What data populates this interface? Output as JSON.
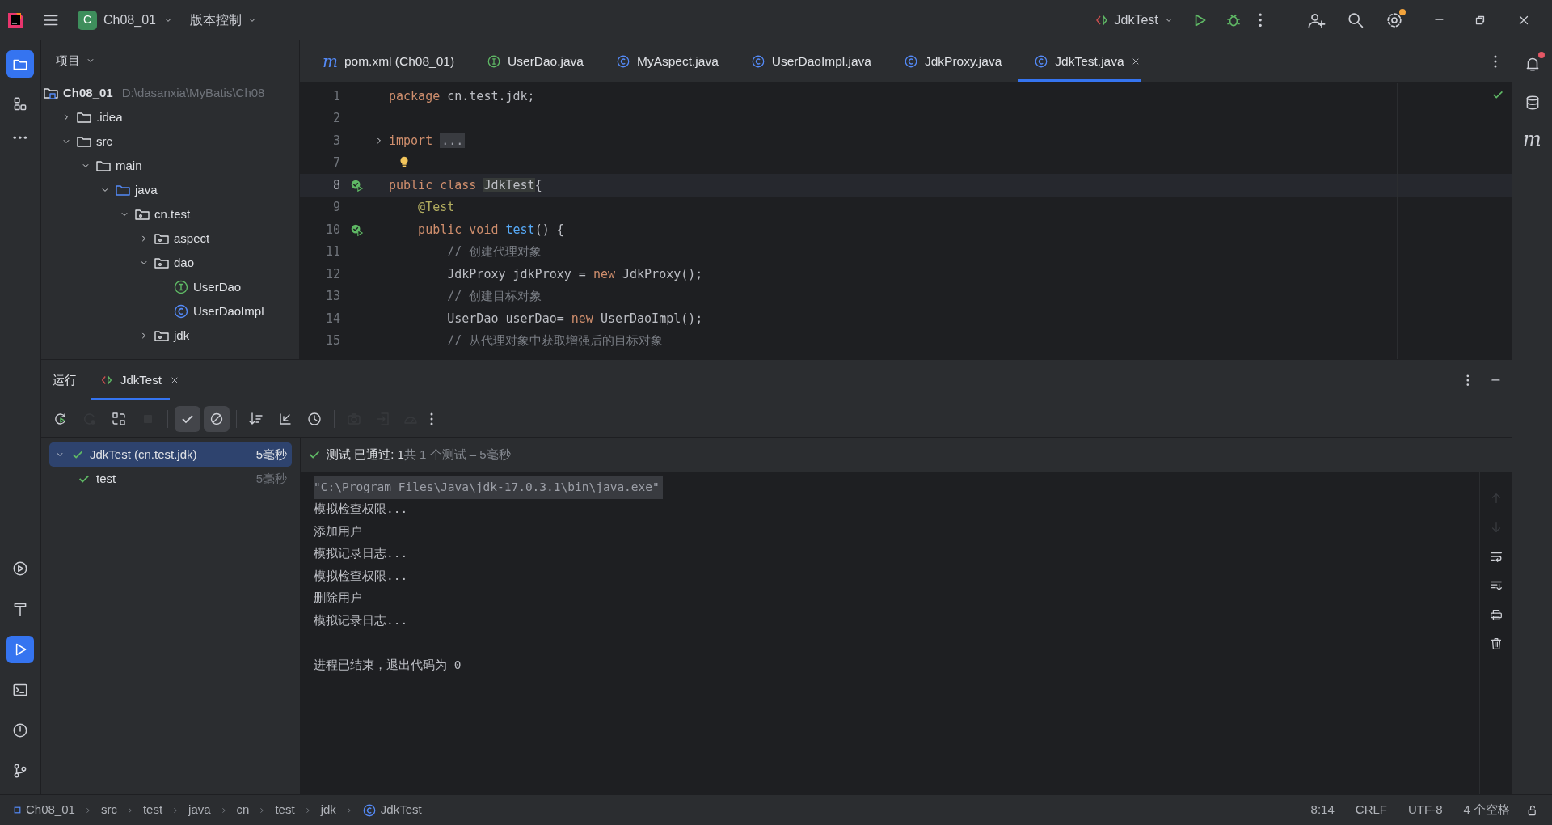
{
  "title_bar": {
    "project_letter": "C",
    "project": "Ch08_01",
    "vcs": "版本控制",
    "run_config": "JdkTest",
    "updates_available": true
  },
  "left_toolbar": {
    "top": [
      {
        "selected": true
      },
      {
        "selected": false
      },
      {
        "selected": false
      }
    ],
    "bottom": [
      {
        "selected": false
      },
      {
        "selected": false
      },
      {
        "selected": true
      },
      {
        "selected": false
      },
      {
        "selected": false
      },
      {
        "selected": false
      }
    ]
  },
  "right_toolbar": {
    "notifications_unread": true,
    "maven_label": "m"
  },
  "project_panel": {
    "title": "项目",
    "tree": [
      {
        "name": "Ch08_01",
        "path": "D:\\dasanxia\\MyBatis\\Ch08_",
        "kind": "module",
        "children": [
          {
            "name": ".idea",
            "kind": "folder",
            "expanded": false
          },
          {
            "name": "src",
            "kind": "folder",
            "expanded": true,
            "children": [
              {
                "name": "main",
                "kind": "folder",
                "expanded": true,
                "children": [
                  {
                    "name": "java",
                    "kind": "source",
                    "expanded": true,
                    "children": [
                      {
                        "name": "cn.test",
                        "kind": "package",
                        "expanded": true,
                        "children": [
                          {
                            "name": "aspect",
                            "kind": "package",
                            "expanded": false
                          },
                          {
                            "name": "dao",
                            "kind": "package",
                            "expanded": true,
                            "children": [
                              {
                                "name": "UserDao",
                                "kind": "interface"
                              },
                              {
                                "name": "UserDaoImpl",
                                "kind": "class"
                              }
                            ]
                          },
                          {
                            "name": "jdk",
                            "kind": "package",
                            "expanded": false
                          }
                        ]
                      }
                    ]
                  }
                ]
              }
            ]
          }
        ]
      }
    ]
  },
  "editor_tabs": [
    {
      "label": "pom.xml (Ch08_01)",
      "kind": "maven",
      "icon_text": "m",
      "selected": false
    },
    {
      "label": "UserDao.java",
      "kind": "interface",
      "selected": false
    },
    {
      "label": "MyAspect.java",
      "kind": "class",
      "selected": false
    },
    {
      "label": "UserDaoImpl.java",
      "kind": "class",
      "selected": false
    },
    {
      "label": "JdkProxy.java",
      "kind": "class",
      "selected": false
    },
    {
      "label": "JdkTest.java",
      "kind": "class",
      "selected": true
    }
  ],
  "code": [
    {
      "number": "1",
      "kind": "plain",
      "current": false,
      "tokens": [
        {
          "text": "package",
          "kind": "kw"
        },
        {
          "text": " cn.test.jdk;",
          "kind": "plain"
        }
      ]
    },
    {
      "number": "2",
      "kind": "plain",
      "current": false
    },
    {
      "number": "3",
      "kind": "fold",
      "current": false,
      "tokens": [
        {
          "text": "import",
          "kind": "kw"
        },
        {
          "text": "...",
          "kind": "folded"
        }
      ]
    },
    {
      "number": "7",
      "kind": "bulb",
      "current": false
    },
    {
      "number": "8",
      "kind": "run",
      "current": true,
      "tokens": [
        {
          "text": "public class ",
          "kind": "kw"
        },
        {
          "text": "JdkTest",
          "kind": "match"
        },
        {
          "text": "{",
          "kind": "plain"
        }
      ]
    },
    {
      "number": "9",
      "kind": "plain",
      "current": false,
      "tokens": [
        {
          "text": "    @Test",
          "kind": "annotation"
        }
      ]
    },
    {
      "number": "10",
      "kind": "run",
      "current": false,
      "tokens": [
        {
          "text": "    public void ",
          "kind": "kw"
        },
        {
          "text": "test",
          "kind": "method"
        },
        {
          "text": "() {",
          "kind": "plain"
        }
      ]
    },
    {
      "number": "11",
      "kind": "plain",
      "current": false,
      "tokens": [
        {
          "text": "        // 创建代理对象",
          "kind": "comment"
        }
      ]
    },
    {
      "number": "12",
      "kind": "plain",
      "current": false,
      "tokens": [
        {
          "text": "        JdkProxy jdkProxy = ",
          "kind": "plain"
        },
        {
          "text": "new",
          "kind": "kw"
        },
        {
          "text": " JdkProxy();",
          "kind": "plain"
        }
      ]
    },
    {
      "number": "13",
      "kind": "plain",
      "current": false,
      "tokens": [
        {
          "text": "        // 创建目标对象",
          "kind": "comment"
        }
      ]
    },
    {
      "number": "14",
      "kind": "plain",
      "current": false,
      "tokens": [
        {
          "text": "        UserDao userDao= ",
          "kind": "plain"
        },
        {
          "text": "new",
          "kind": "kw"
        },
        {
          "text": " UserDaoImpl();",
          "kind": "plain"
        }
      ]
    },
    {
      "number": "15",
      "kind": "plain",
      "current": false,
      "tokens": [
        {
          "text": "        // 从代理对象中获取增强后的目标对象",
          "kind": "comment"
        }
      ]
    }
  ],
  "run_panel": {
    "title": "运行",
    "tabs": [
      {
        "label": "JdkTest",
        "selected": true
      }
    ],
    "toolbar": [
      {
        "disabled": false,
        "toggled": false
      },
      {
        "disabled": true,
        "toggled": false
      },
      {
        "disabled": false,
        "toggled": false
      },
      {
        "disabled": true,
        "toggled": false
      },
      {
        "disabled": false,
        "toggled": true
      },
      {
        "disabled": false,
        "toggled": true
      },
      {
        "disabled": false,
        "toggled": false
      },
      {
        "disabled": false,
        "toggled": false
      },
      {
        "disabled": false,
        "toggled": false
      },
      {
        "disabled": true,
        "toggled": false
      },
      {
        "disabled": true,
        "toggled": false
      },
      {
        "disabled": true,
        "toggled": false
      },
      {
        "disabled": false,
        "toggled": false
      }
    ],
    "tests": [
      {
        "name": "JdkTest (cn.test.jdk)",
        "time": "5毫秒",
        "passed": true,
        "selected": true,
        "expanded": true,
        "children": [
          {
            "name": "test",
            "time": "5毫秒",
            "passed": true,
            "selected": false
          }
        ]
      }
    ],
    "summary": {
      "passed": true,
      "status": "测试 已通过: 1",
      "detail": "共 1 个测试 – 5毫秒"
    },
    "console": [
      {
        "kind": "command",
        "text": "\"C:\\Program Files\\Java\\jdk-17.0.3.1\\bin\\java.exe\""
      },
      {
        "kind": "output",
        "text": "模拟检查权限..."
      },
      {
        "kind": "output",
        "text": "添加用户"
      },
      {
        "kind": "output",
        "text": "模拟记录日志..."
      },
      {
        "kind": "output",
        "text": "模拟检查权限..."
      },
      {
        "kind": "output",
        "text": "删除用户"
      },
      {
        "kind": "output",
        "text": "模拟记录日志..."
      },
      {
        "kind": "exit",
        "text": "进程已结束，退出代码为 0"
      }
    ]
  },
  "status_bar": {
    "breadcrumbs": [
      {
        "label": "Ch08_01",
        "kind": "module"
      },
      {
        "label": "src"
      },
      {
        "label": "test"
      },
      {
        "label": "java"
      },
      {
        "label": "cn"
      },
      {
        "label": "test"
      },
      {
        "label": "jdk"
      },
      {
        "label": "JdkTest",
        "kind": "class"
      }
    ],
    "position": "8:14",
    "line_separator": "CRLF",
    "encoding": "UTF-8",
    "indent": "4 个空格"
  }
}
